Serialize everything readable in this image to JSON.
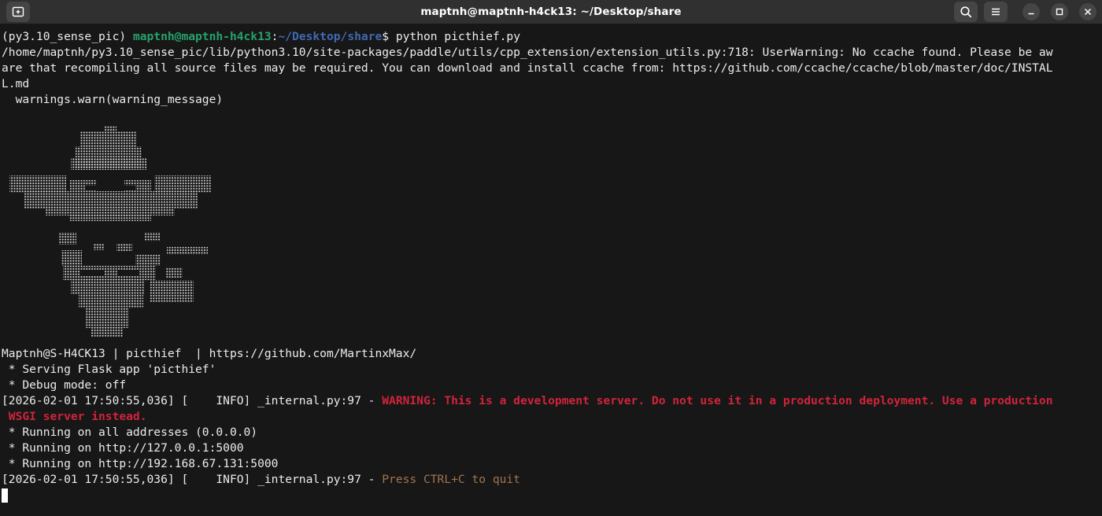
{
  "window": {
    "title": "maptnh@maptnh-h4ck13: ~/Desktop/share",
    "icons": {
      "new_tab": "new-tab-icon",
      "search": "search-icon",
      "menu": "hamburger-menu-icon",
      "minimize": "minimize-icon",
      "maximize": "maximize-icon",
      "close": "close-icon"
    }
  },
  "prompt": {
    "env": "(py3.10_sense_pic) ",
    "user_host": "maptnh@maptnh-h4ck13",
    "sep": ":",
    "path": "~/Desktop/share",
    "symbol": "$ ",
    "command": "python picthief.py"
  },
  "warning": {
    "line1": "/home/maptnh/py3.10_sense_pic/lib/python3.10/site-packages/paddle/utils/cpp_extension/extension_utils.py:718: UserWarning: No ccache found. Please be aw",
    "line2": "are that recompiling all source files may be required. You can download and install ccache from: https://github.com/ccache/ccache/blob/master/doc/INSTAL",
    "line3": "L.md",
    "line4": "  warnings.warn(warning_message)"
  },
  "banner_line": "Maptnh@S-H4CK13 | picthief  | https://github.com/MartinxMax/",
  "flask": {
    "serving": " * Serving Flask app 'picthief'",
    "debug": " * Debug mode: off",
    "log1_prefix": "[2026-02-01 17:50:55,036] [    INFO] _internal.py:97 - ",
    "log1_msg_a": "WARNING: This is a development server. Do not use it in a production deployment. Use a production",
    "log1_msg_b": " WSGI server instead.",
    "running_all": " * Running on all addresses (0.0.0.0)",
    "running_local": " * Running on http://127.0.0.1:5000",
    "running_lan": " * Running on http://192.168.67.131:5000",
    "log2_prefix": "[2026-02-01 17:50:55,036] [    INFO] _internal.py:97 - ",
    "log2_msg": "Press CTRL+C to quit"
  },
  "colors": {
    "background": "#171717",
    "titlebar": "#303030",
    "prompt_user": "#26a269",
    "prompt_path": "#3f6ab3",
    "log_warning": "#d0243a",
    "log_hint": "#a2734c"
  }
}
